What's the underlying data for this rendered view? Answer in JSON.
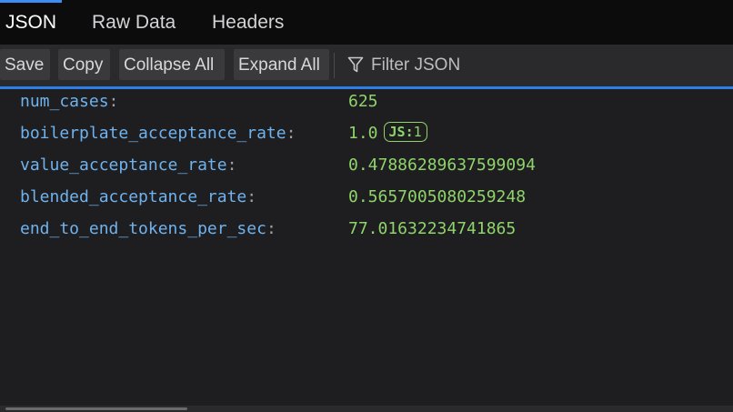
{
  "tabs": [
    {
      "label": "JSON",
      "active": true
    },
    {
      "label": "Raw Data",
      "active": false
    },
    {
      "label": "Headers",
      "active": false
    }
  ],
  "toolbar": {
    "save_label": "Save",
    "copy_label": "Copy",
    "collapse_label": "Collapse All",
    "expand_label": "Expand All",
    "filter_placeholder": "Filter JSON"
  },
  "json": {
    "rows": [
      {
        "key": "num_cases",
        "value": "625"
      },
      {
        "key": "boilerplate_acceptance_rate",
        "value": "1.0",
        "badge": {
          "prefix": "JS:",
          "text": "1"
        }
      },
      {
        "key": "value_acceptance_rate",
        "value": "0.47886289637599094"
      },
      {
        "key": "blended_acceptance_rate",
        "value": "0.5657005080259248"
      },
      {
        "key": "end_to_end_tokens_per_sec",
        "value": "77.01632234741865"
      }
    ]
  },
  "colors": {
    "accent": "#2f7fe8",
    "key": "#6fb2ee",
    "value": "#8fd46b",
    "background": "#1e1e20"
  },
  "icons": {
    "filter": "filter-funnel-icon"
  }
}
